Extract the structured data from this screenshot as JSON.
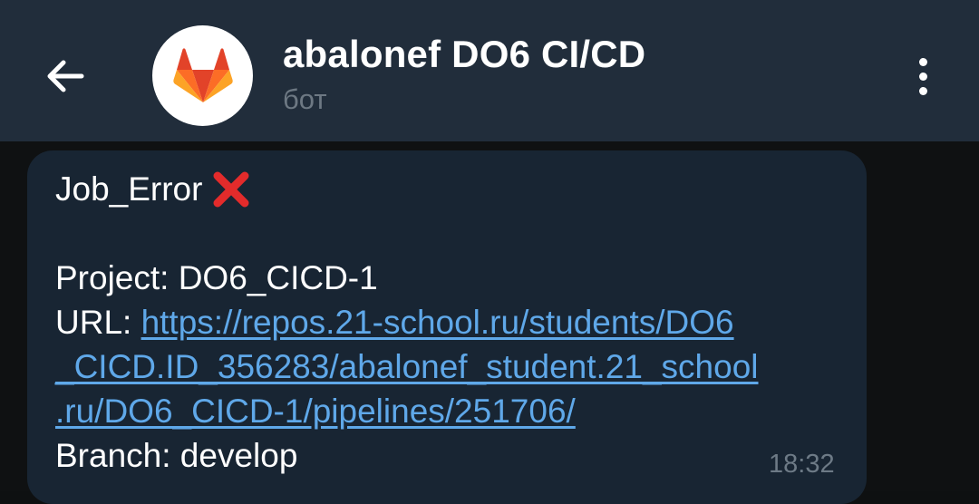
{
  "header": {
    "title": "abalonef DO6 CI/CD",
    "subtitle": "бот",
    "back_icon": "arrow-left-icon",
    "avatar_icon": "gitlab-logo",
    "menu_icon": "more-vertical-icon"
  },
  "message": {
    "title": "Job_Error",
    "status_icon": "red-cross-icon",
    "project_line": "Project: DO6_CICD-1",
    "url_label": "URL: ",
    "url_line1": "https://repos.21-school.ru/students/DO6",
    "url_line2": "_CICD.ID_356283/abalonef_student.21_school",
    "url_line3": ".ru/DO6_CICD-1/pipelines/251706/",
    "branch_line": "Branch: develop",
    "time": "18:32"
  },
  "colors": {
    "header_bg": "#212d3b",
    "bubble_bg": "#182533",
    "link": "#5fa8e9",
    "cross": "#e32b2b"
  }
}
